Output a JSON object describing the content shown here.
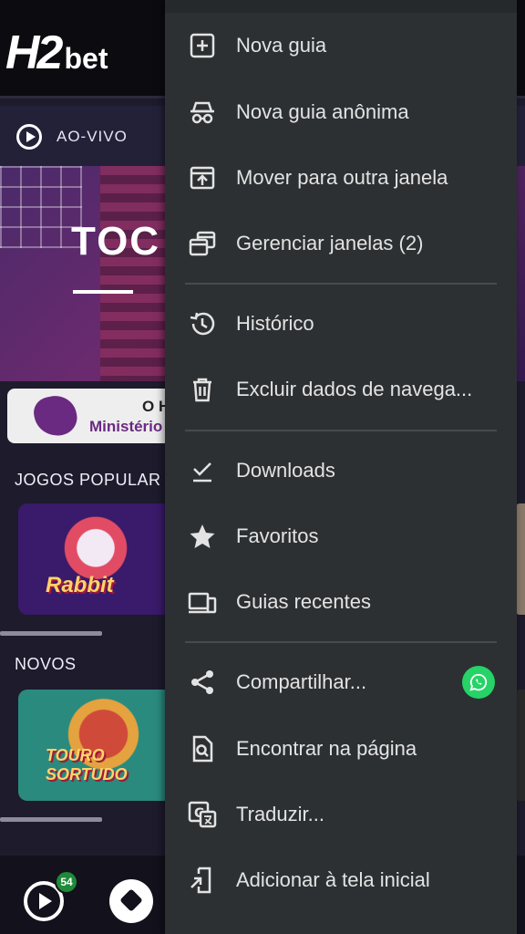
{
  "site": {
    "logo_h2": "H2",
    "logo_bet": "bet",
    "live_tab_label": "AO-VIVO",
    "hero_title": "TOC",
    "notice_line1": "O H",
    "notice_line2": "Ministério",
    "section_popular": "JOGOS POPULAR",
    "section_new": "NOVOS",
    "game_rabbit_text": "Rabbit",
    "game_touro_text": "TOURO SORTUDO",
    "bottom_badge": "54"
  },
  "menu": {
    "items": [
      {
        "label": "Nova guia",
        "icon": "new-tab-icon"
      },
      {
        "label": "Nova guia anônima",
        "icon": "incognito-icon"
      },
      {
        "label": "Mover para outra janela",
        "icon": "move-window-icon"
      },
      {
        "label": "Gerenciar janelas (2)",
        "icon": "manage-windows-icon"
      },
      {
        "label": "Histórico",
        "icon": "history-icon"
      },
      {
        "label": "Excluir dados de navega...",
        "icon": "trash-icon"
      },
      {
        "label": "Downloads",
        "icon": "download-check-icon"
      },
      {
        "label": "Favoritos",
        "icon": "star-icon"
      },
      {
        "label": "Guias recentes",
        "icon": "recent-tabs-icon"
      },
      {
        "label": "Compartilhar...",
        "icon": "share-icon"
      },
      {
        "label": "Encontrar na página",
        "icon": "find-in-page-icon"
      },
      {
        "label": "Traduzir...",
        "icon": "translate-icon"
      },
      {
        "label": "Adicionar à tela inicial",
        "icon": "add-to-home-icon"
      }
    ]
  },
  "colors": {
    "menu_bg": "#2d3033",
    "menu_text": "#e3e3e3",
    "whatsapp_green": "#25d366",
    "site_bg": "#1d1b2c"
  }
}
